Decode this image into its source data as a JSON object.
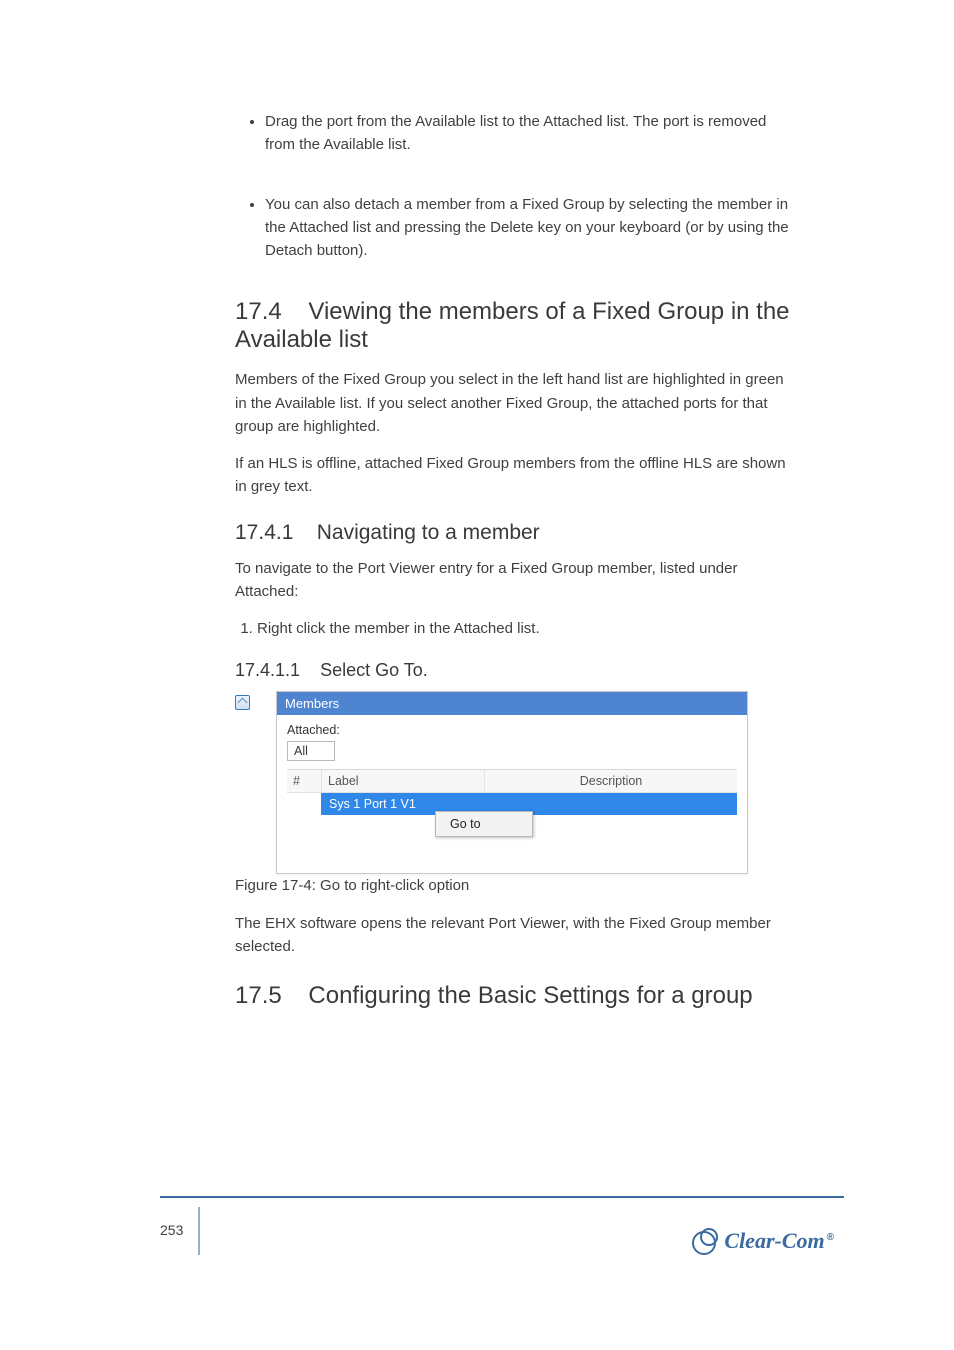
{
  "bullets": {
    "0": "Drag the port from the Available list to the Attached list. The port is removed from the Available list.",
    "1": "You can also detach a member from a Fixed Group by selecting the member in the Attached list and pressing the Delete key on your keyboard (or by using the Detach button). "
  },
  "heading": {
    "num": "17.4",
    "title": "Viewing the members of a Fixed Group in the Available list"
  },
  "body": {
    "avail_members_para": "Members of the Fixed Group you select in the left hand list are highlighted in green in the Available list. If you select another Fixed Group, the attached ports for that group are highlighted.",
    "hls_para": "If an HLS is offline, attached Fixed Group members from the offline HLS are shown in grey text."
  },
  "subsection": {
    "num": "17.4.1",
    "title": "Navigating to a member"
  },
  "nav_para": "To navigate to the Port Viewer entry for a Fixed Group member, listed under Attached:",
  "nav_steps": {
    "0": "Right click the member in the Attached list."
  },
  "subsub": {
    "num": "17.4.1.1",
    "title": "Select Go To."
  },
  "window": {
    "title": "Members",
    "attached_label": "Attached:",
    "attached_value": "All",
    "col_hash": "#",
    "col_label": "Label",
    "col_desc": "Description",
    "row_label": "Sys 1 Port 1 V1",
    "context_goto": "Go to"
  },
  "figure_caption": "Figure 17-4: Go to right-click option",
  "open_body_para": "The EHX software opens the relevant Port Viewer, with the Fixed Group member selected.",
  "section2": {
    "num": "17.5",
    "title": "Configuring the Basic Settings for a group"
  },
  "footer": {
    "page": "253"
  },
  "logo": {
    "text": "Clear-Com"
  }
}
